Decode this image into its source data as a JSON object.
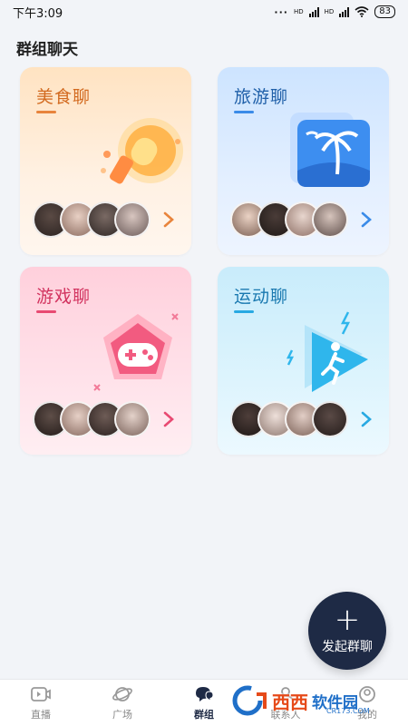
{
  "status_bar": {
    "time": "下午3:09",
    "battery": "83",
    "network_1": "HD",
    "network_2": "HD"
  },
  "page": {
    "title": "群组聊天"
  },
  "cards": [
    {
      "title": "美食聊",
      "accent": "#e8843c",
      "icon": "ice-cream-icon"
    },
    {
      "title": "旅游聊",
      "accent": "#3a8be8",
      "icon": "palm-tree-icon"
    },
    {
      "title": "游戏聊",
      "accent": "#e84a72",
      "icon": "gamepad-icon"
    },
    {
      "title": "运动聊",
      "accent": "#28a9e2",
      "icon": "running-icon"
    }
  ],
  "fab": {
    "plus": "+",
    "label": "发起群聊"
  },
  "bottom_nav": [
    {
      "label": "直播",
      "icon": "live-video-icon"
    },
    {
      "label": "广场",
      "icon": "planet-icon"
    },
    {
      "label": "群组",
      "icon": "group-chat-icon",
      "active": true
    },
    {
      "label": "联系人",
      "icon": "contacts-icon"
    },
    {
      "label": "我的",
      "icon": "profile-icon"
    }
  ],
  "watermark": {
    "brand": "西西",
    "soft": "软件园",
    "url": "CR173.COM"
  }
}
